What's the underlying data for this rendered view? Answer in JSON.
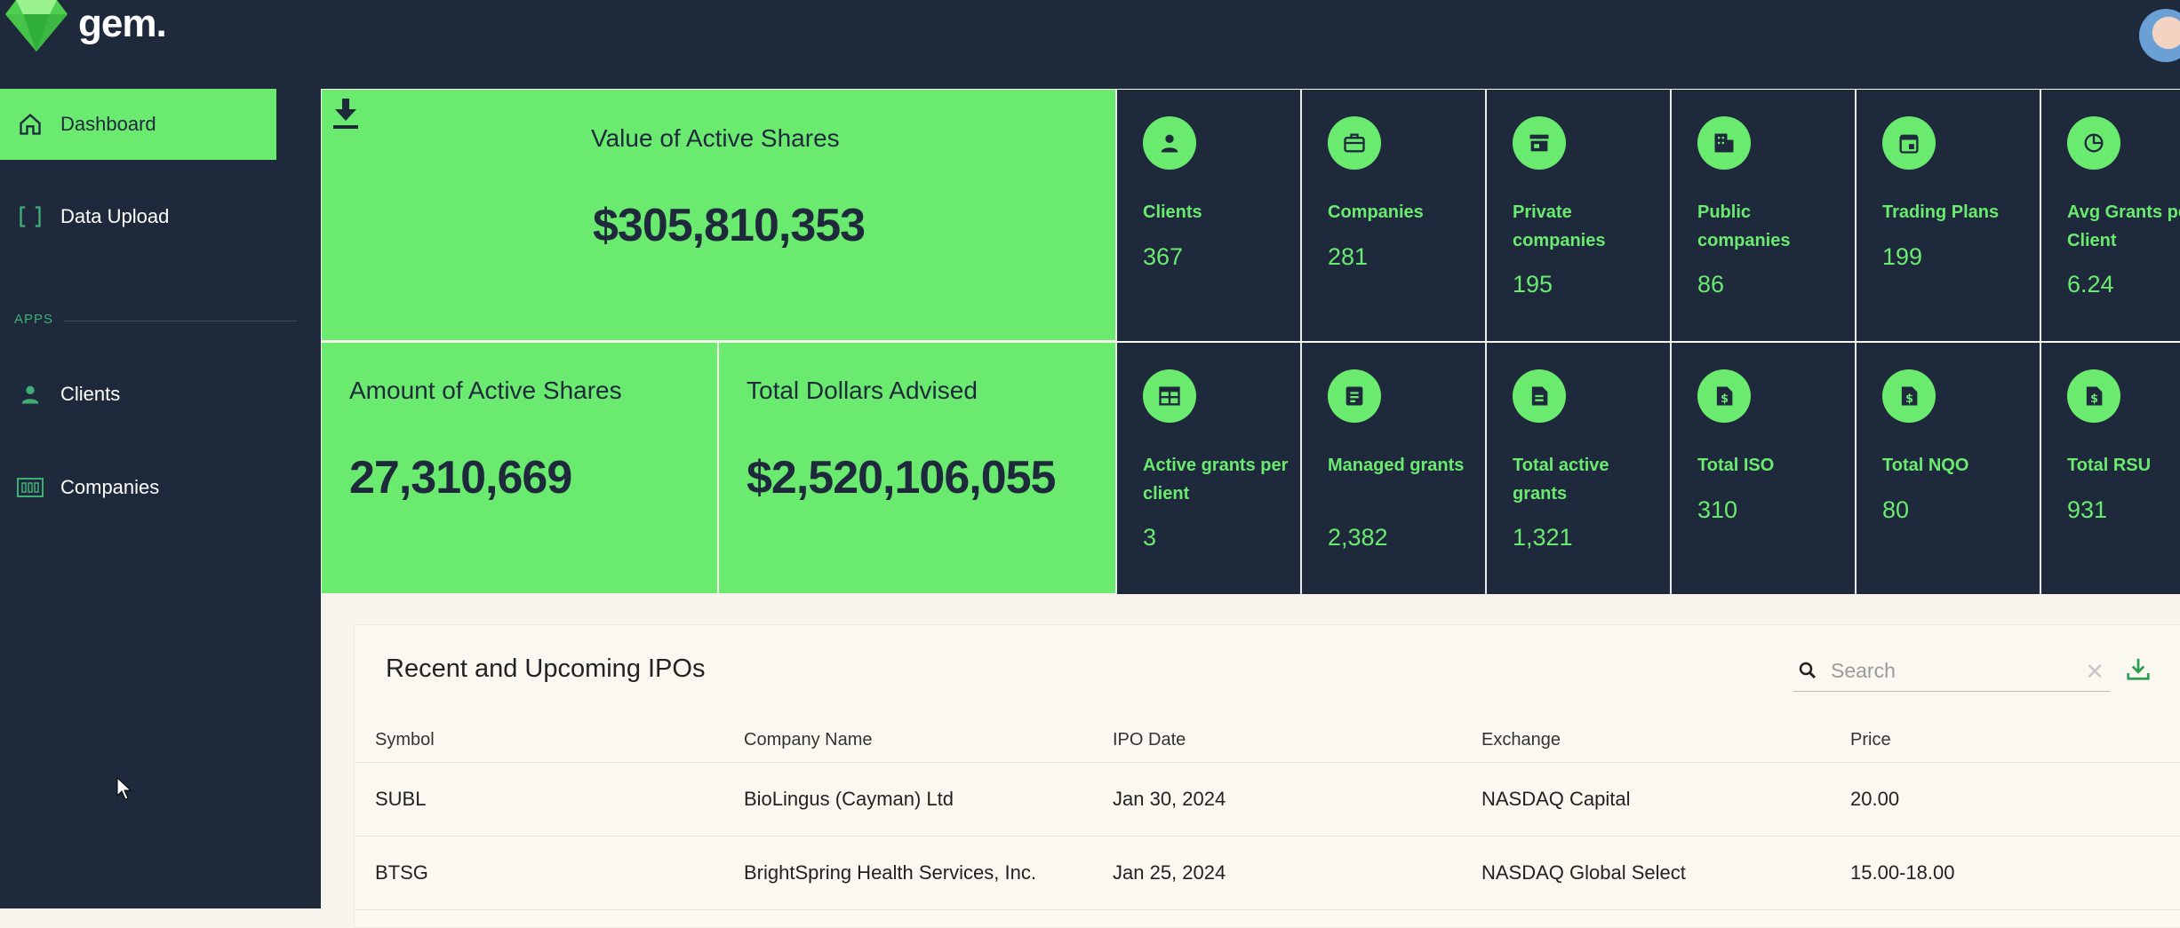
{
  "app": {
    "logo_text": "gem."
  },
  "sidebar": {
    "items": [
      {
        "label": "Dashboard"
      },
      {
        "label": "Data Upload"
      },
      {
        "label": "Clients"
      },
      {
        "label": "Companies"
      }
    ],
    "section_label": "APPS"
  },
  "summary": {
    "active_value": {
      "title": "Value of Active Shares",
      "value": "$305,810,353"
    },
    "active_amount": {
      "title": "Amount of Active Shares",
      "value": "27,310,669"
    },
    "total_advised": {
      "title": "Total Dollars Advised",
      "value": "$2,520,106,055"
    }
  },
  "tiles": [
    {
      "label": "Clients",
      "value": "367",
      "icon": "person-icon"
    },
    {
      "label": "Companies",
      "value": "281",
      "icon": "briefcase-icon"
    },
    {
      "label": "Private companies",
      "value": "195",
      "icon": "store-icon"
    },
    {
      "label": "Public companies",
      "value": "86",
      "icon": "building-icon"
    },
    {
      "label": "Trading Plans",
      "value": "199",
      "icon": "calendar-icon"
    },
    {
      "label": "Avg Grants per Client",
      "value": "6.24",
      "icon": "pie-chart-icon"
    },
    {
      "label": "Active grants per client",
      "value": "3",
      "icon": "calendar-grid-icon"
    },
    {
      "label": "Managed grants",
      "value": "2,382",
      "icon": "document-icon"
    },
    {
      "label": "Total active grants",
      "value": "1,321",
      "icon": "file-icon"
    },
    {
      "label": "Total ISO",
      "value": "310",
      "icon": "dollar-file-icon"
    },
    {
      "label": "Total NQO",
      "value": "80",
      "icon": "dollar-file-icon"
    },
    {
      "label": "Total RSU",
      "value": "931",
      "icon": "dollar-file-icon"
    }
  ],
  "ipos": {
    "title": "Recent and Upcoming IPOs",
    "search_placeholder": "Search",
    "columns": [
      "Symbol",
      "Company Name",
      "IPO Date",
      "Exchange",
      "Price"
    ],
    "rows": [
      [
        "SUBL",
        "BioLingus (Cayman) Ltd",
        "Jan 30, 2024",
        "NASDAQ Capital",
        "20.00"
      ],
      [
        "BTSG",
        "BrightSpring Health Services, Inc.",
        "Jan 25, 2024",
        "NASDAQ Global Select",
        "15.00-18.00"
      ]
    ]
  },
  "colors": {
    "accent": "#6aea6f",
    "navy": "#1e2a3c",
    "background": "#f7f5ee"
  }
}
